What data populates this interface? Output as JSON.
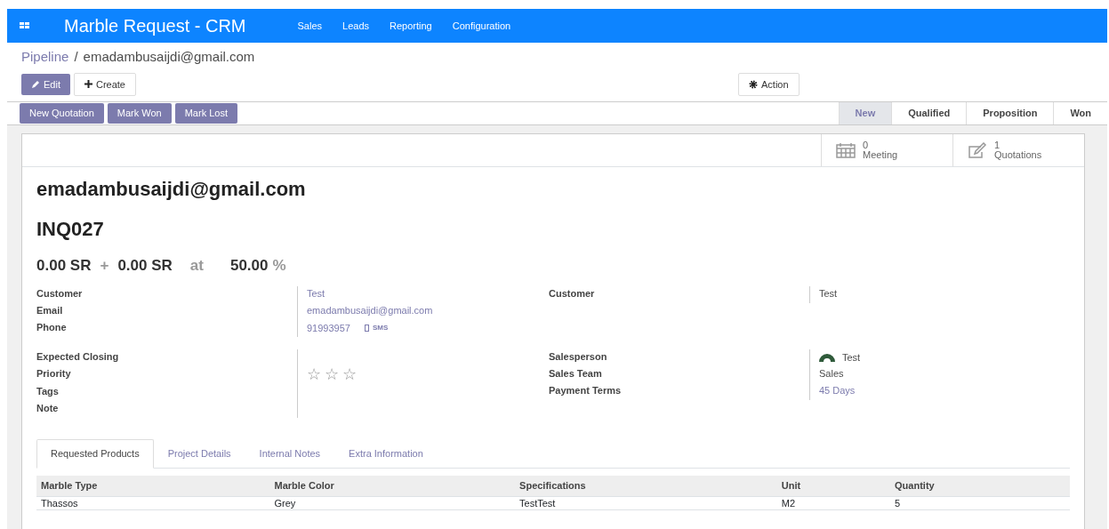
{
  "navbar": {
    "title": "Marble Request - CRM",
    "menu": [
      "Sales",
      "Leads",
      "Reporting",
      "Configuration"
    ]
  },
  "breadcrumb": {
    "parent": "Pipeline",
    "separator": "/",
    "current": "emadambusaijdi@gmail.com"
  },
  "toolbar": {
    "edit": "Edit",
    "create": "Create",
    "action": "Action"
  },
  "header_buttons": [
    "New Quotation",
    "Mark Won",
    "Mark Lost"
  ],
  "stages": [
    {
      "label": "New",
      "selected": true
    },
    {
      "label": "Qualified",
      "selected": false
    },
    {
      "label": "Proposition",
      "selected": false
    },
    {
      "label": "Won",
      "selected": false
    }
  ],
  "smart_buttons": [
    {
      "kind": "calendar",
      "count": "0",
      "label": "Meeting"
    },
    {
      "kind": "edit",
      "count": "1",
      "label": "Quotations"
    }
  ],
  "title": "emadambusaijdi@gmail.com",
  "reference": "INQ027",
  "revenue": {
    "expected": "0.00 SR",
    "plus": "+",
    "prorated": "0.00 SR",
    "at": "at",
    "probability": "50.00",
    "percent": "%"
  },
  "left_fields": [
    {
      "label": "Customer",
      "value": "Test",
      "kind": "link"
    },
    {
      "label": "Email",
      "value": "emadambusaijdi@gmail.com",
      "kind": "link"
    },
    {
      "label": "Phone",
      "value": "91993957",
      "kind": "phone",
      "extra": "SMS"
    }
  ],
  "left_fields_2": [
    {
      "label": "Expected Closing",
      "kind": "empty"
    },
    {
      "label": "Priority",
      "kind": "stars",
      "stars": 0
    },
    {
      "label": "Tags",
      "kind": "empty"
    },
    {
      "label": "Note",
      "kind": "empty"
    }
  ],
  "right_fields": [
    {
      "label": "Customer",
      "value": "Test",
      "kind": "text"
    }
  ],
  "right_fields_2": [
    {
      "label": "Salesperson",
      "value": "Test",
      "kind": "user"
    },
    {
      "label": "Sales Team",
      "value": "Sales",
      "kind": "text"
    },
    {
      "label": "Payment Terms",
      "value": "45 Days",
      "kind": "link"
    }
  ],
  "tabs": [
    {
      "label": "Requested Products",
      "selected": true
    },
    {
      "label": "Project Details",
      "selected": false
    },
    {
      "label": "Internal Notes",
      "selected": false
    },
    {
      "label": "Extra Information",
      "selected": false
    }
  ],
  "table": {
    "columns": [
      "Marble Type",
      "Marble Color",
      "Specifications",
      "Unit",
      "Quantity"
    ],
    "rows": [
      [
        "Thassos",
        "Grey",
        "TestTest",
        "M2",
        "5"
      ]
    ]
  }
}
